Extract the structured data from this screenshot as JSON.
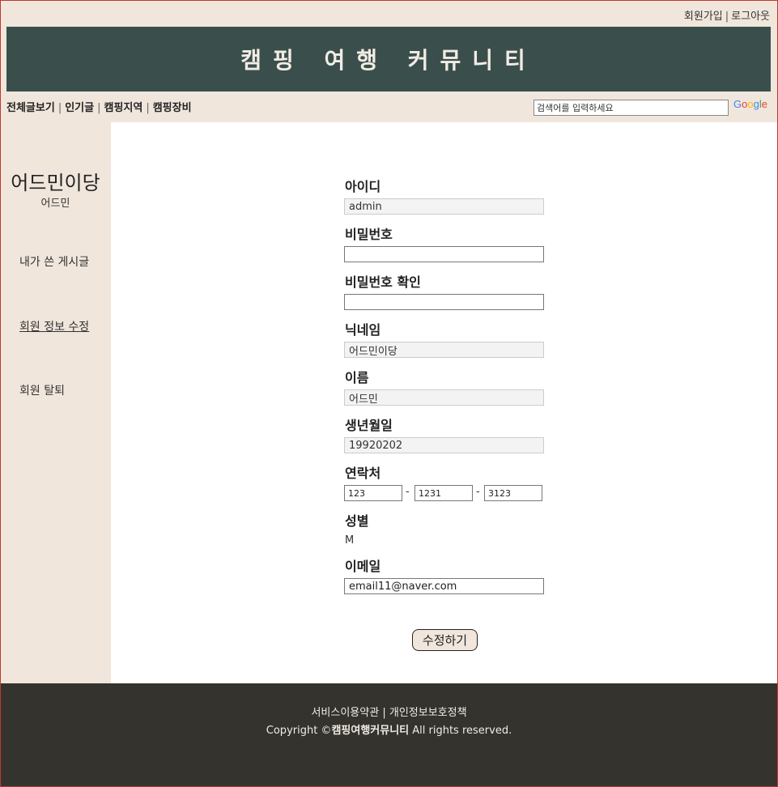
{
  "top_links": {
    "signup": "회원가입",
    "separator": "|",
    "logout": "로그아웃"
  },
  "header": {
    "title": "캠핑 여행 커뮤니티"
  },
  "nav": {
    "items": [
      "전체글보기",
      "인기글",
      "캠핑지역",
      "캠핑장비"
    ],
    "separator": "|"
  },
  "search": {
    "placeholder": "검색어를 입력하세요",
    "logo_letters": [
      "G",
      "o",
      "o",
      "g",
      "l",
      "e"
    ]
  },
  "sidebar": {
    "nickname": "어드민이당",
    "name": "어드민",
    "links": [
      "내가 쓴 게시글",
      "회원 정보 수정",
      "회원 탈퇴"
    ],
    "active_index": 1
  },
  "form": {
    "id_label": "아이디",
    "id_value": "admin",
    "password_label": "비밀번호",
    "password_value": "",
    "password_confirm_label": "비밀번호 확인",
    "password_confirm_value": "",
    "nickname_label": "닉네임",
    "nickname_value": "어드민이당",
    "name_label": "이름",
    "name_value": "어드민",
    "birth_label": "생년월일",
    "birth_value": "19920202",
    "phone_label": "연락처",
    "phone1": "123",
    "phone2": "1231",
    "phone3": "3123",
    "phone_dash": "-",
    "gender_label": "성별",
    "gender_value": "M",
    "email_label": "이메일",
    "email_value": "email11@naver.com",
    "submit_label": "수정하기"
  },
  "footer": {
    "terms": "서비스이용약관",
    "separator": "|",
    "privacy": "개인정보보호정책",
    "copyright_prefix": "Copyright ©",
    "copyright_brand": "캠핑여행커뮤니티",
    "copyright_suffix": " All rights reserved."
  },
  "colors": {
    "background": "#f0e6dc",
    "header_bg": "#3a4f4c",
    "footer_bg": "#34332e",
    "border": "#c0392b"
  }
}
